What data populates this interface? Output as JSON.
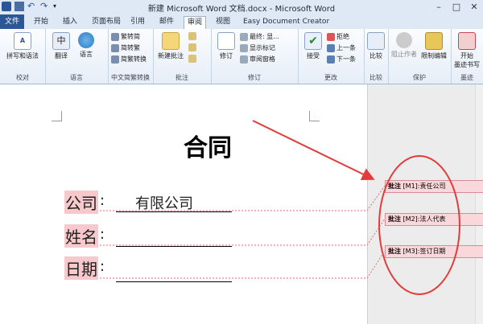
{
  "window": {
    "title": "新建 Microsoft Word 文档.docx - Microsoft Word",
    "minimize": "–",
    "maximize": "□",
    "close": "✕"
  },
  "tabs": [
    "文件",
    "开始",
    "插入",
    "页面布局",
    "引用",
    "邮件",
    "审阅",
    "视图",
    "Easy Document Creator"
  ],
  "active_tab": "审阅",
  "ribbon": {
    "proofing": {
      "label": "校对",
      "spell": "拼写和语法"
    },
    "language": {
      "label": "语言",
      "translate": "翻译",
      "lang": "语言"
    },
    "chinese": {
      "label": "中文简繁转换",
      "t2s": "繁转简",
      "s2t": "简转繁",
      "convert": "简繁转换"
    },
    "comments": {
      "label": "批注",
      "new": "新建批注"
    },
    "tracking": {
      "label": "修订",
      "track": "修订",
      "final": "最终: 显...",
      "show_markup": "显示标记",
      "pane": "审阅窗格"
    },
    "changes": {
      "label": "更改",
      "accept": "接受",
      "reject": "拒绝",
      "prev": "上一条",
      "next": "下一条"
    },
    "compare": {
      "label": "比较",
      "compare": "比较"
    },
    "protect": {
      "label": "保护",
      "block": "阻止作者",
      "restrict": "限制编辑"
    },
    "ink": {
      "label": "墨迹",
      "start": "开始",
      "start2": "墨迹书写"
    }
  },
  "document": {
    "title": "合同",
    "fields": [
      {
        "label": "公司",
        "colon": ":",
        "value": "有限公司"
      },
      {
        "label": "姓名",
        "colon": ":",
        "value": ""
      },
      {
        "label": "日期",
        "colon": ":",
        "value": ""
      }
    ]
  },
  "comments": [
    {
      "tag": "批注",
      "ref": "[M1]:",
      "text": "责任公司"
    },
    {
      "tag": "批注",
      "ref": "[M2]:",
      "text": "法人代表"
    },
    {
      "tag": "批注",
      "ref": "[M3]:",
      "text": "签订日期"
    }
  ],
  "colors": {
    "annotation": "#e33a3a",
    "comment_fill": "#f9d7da",
    "highlight": "#f7c9cc",
    "file_tab": "#2b5797"
  }
}
